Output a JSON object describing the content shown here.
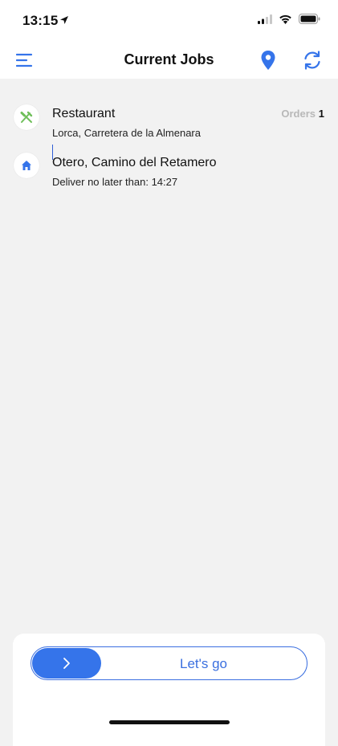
{
  "status": {
    "time": "13:15"
  },
  "nav": {
    "title": "Current Jobs"
  },
  "jobs": [
    {
      "title": "Restaurant",
      "subtitle": "Lorca, Carretera de la Almenara",
      "orders_label": "Orders",
      "orders_count": "1",
      "icon": "fork-knife-icon"
    },
    {
      "title": "Otero, Camino del Retamero",
      "subtitle": "Deliver no later than: 14:27",
      "icon": "home-icon"
    }
  ],
  "action": {
    "label": "Let's go"
  },
  "colors": {
    "accent": "#3574ea",
    "background": "#f2f2f2",
    "restaurant_icon": "#6fbf5a"
  }
}
